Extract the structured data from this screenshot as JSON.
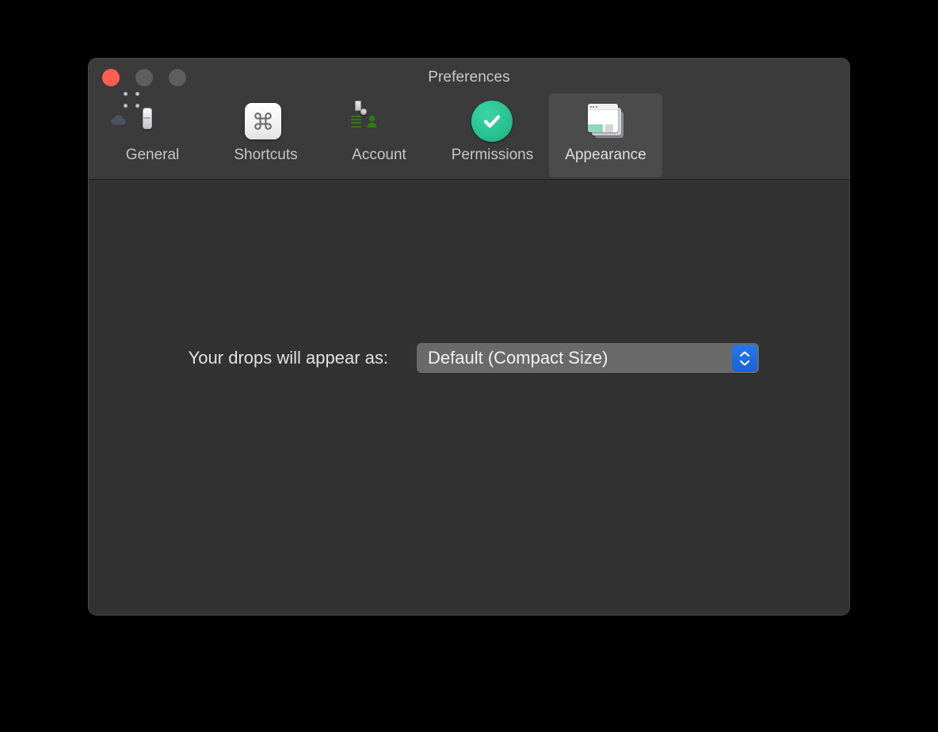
{
  "window": {
    "title": "Preferences",
    "traffic_lights": [
      {
        "name": "close",
        "color": "#ff5f52",
        "enabled": true
      },
      {
        "name": "minimize",
        "color": "#5e5e5e",
        "enabled": false
      },
      {
        "name": "zoom",
        "color": "#5e5e5e",
        "enabled": false
      }
    ]
  },
  "toolbar": {
    "tabs": [
      {
        "id": "general",
        "label": "General",
        "icon": "toggle-switch-cloud-icon",
        "selected": false
      },
      {
        "id": "shortcuts",
        "label": "Shortcuts",
        "icon": "command-key-icon",
        "selected": false
      },
      {
        "id": "account",
        "label": "Account",
        "icon": "id-badge-icon",
        "selected": false
      },
      {
        "id": "permissions",
        "label": "Permissions",
        "icon": "green-checkmark-icon",
        "selected": false
      },
      {
        "id": "appearance",
        "label": "Appearance",
        "icon": "stacked-windows-icon",
        "selected": true
      }
    ]
  },
  "appearance_pane": {
    "drops_label": "Your drops will appear as:",
    "drops_popup": {
      "value": "Default (Compact Size)",
      "stepper_icon": "up-down-chevrons-icon"
    }
  },
  "colors": {
    "desktop": "#000000",
    "window_background": "#323232",
    "toolbar_background": "#3b3b3b",
    "selected_tab_background": "#4b4b4b",
    "popup_background": "#6a6a6a",
    "accent_blue": "#2878e8",
    "permissions_green": "#27c391",
    "close_red": "#ff5f52"
  }
}
